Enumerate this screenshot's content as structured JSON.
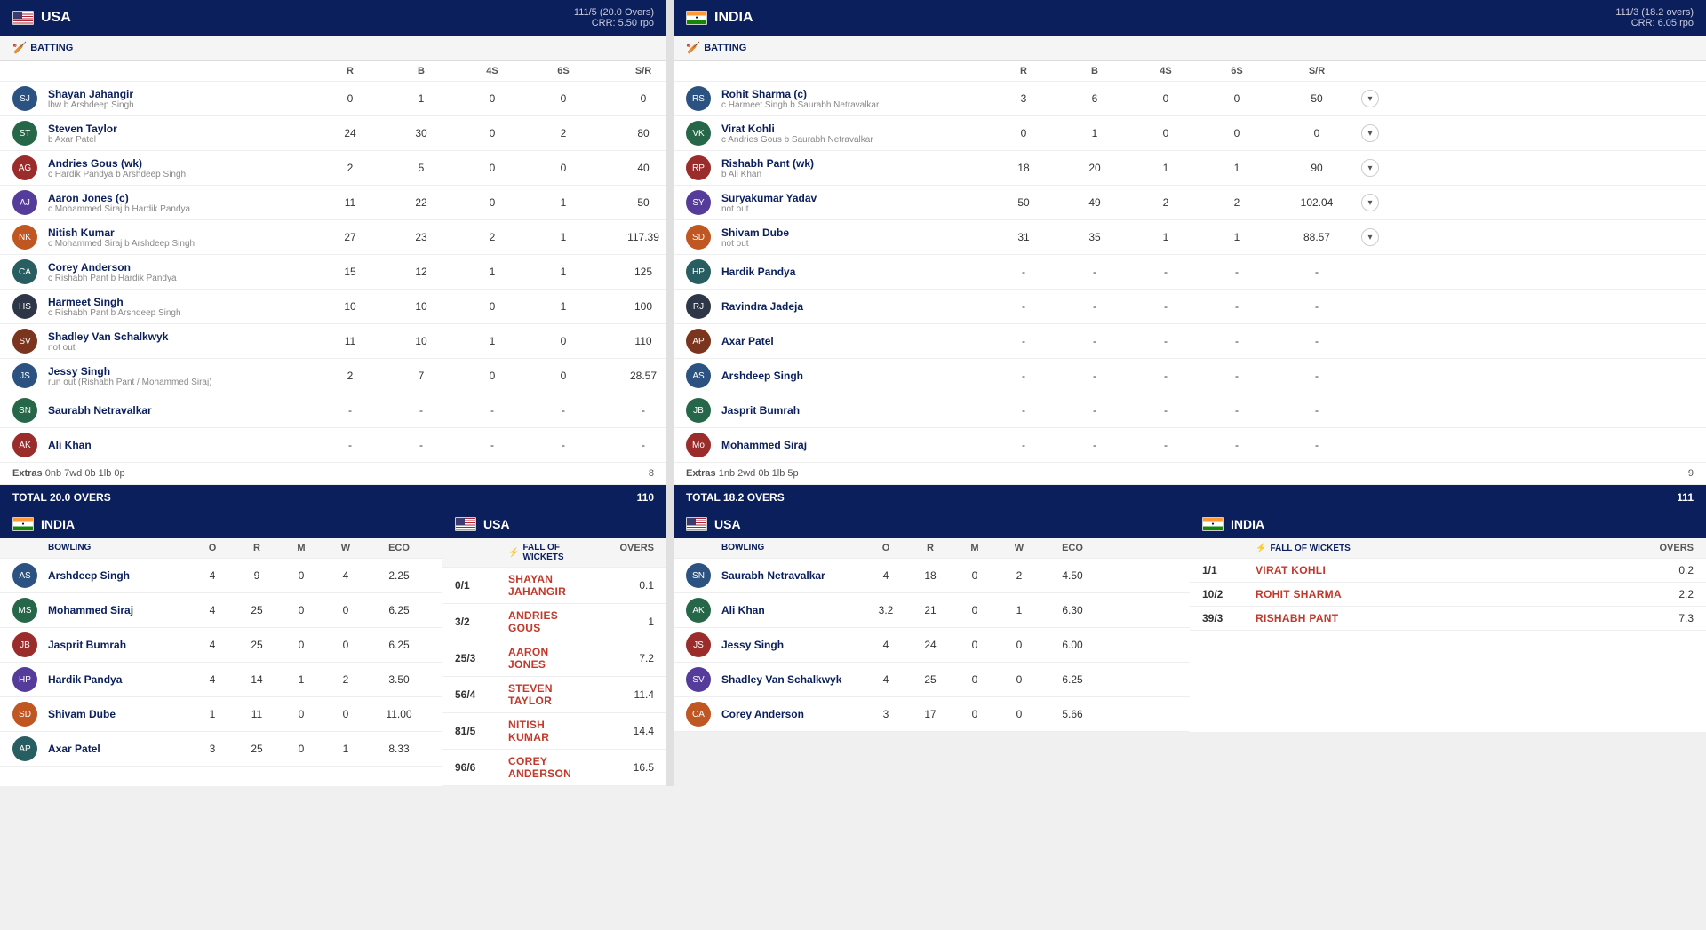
{
  "usa_batting": {
    "team": "USA",
    "score_header": "111/5 (20.0 Overs)",
    "crr": "CRR: 5.50 rpo",
    "batting_label": "BATTING",
    "columns": [
      "R",
      "B",
      "4S",
      "6S",
      "S/R"
    ],
    "players": [
      {
        "name": "Shayan Jahangir",
        "detail": "lbw b Arshdeep Singh",
        "r": "0",
        "b": "1",
        "4s": "0",
        "6s": "0",
        "sr": "0"
      },
      {
        "name": "Steven Taylor",
        "detail": "b Axar Patel",
        "r": "24",
        "b": "30",
        "4s": "0",
        "6s": "2",
        "sr": "80"
      },
      {
        "name": "Andries Gous (wk)",
        "detail": "c Hardik Pandya b Arshdeep Singh",
        "r": "2",
        "b": "5",
        "4s": "0",
        "6s": "0",
        "sr": "40"
      },
      {
        "name": "Aaron Jones (c)",
        "detail": "c Mohammed Siraj b Hardik Pandya",
        "r": "11",
        "b": "22",
        "4s": "0",
        "6s": "1",
        "sr": "50"
      },
      {
        "name": "Nitish Kumar",
        "detail": "c Mohammed Siraj b Arshdeep Singh",
        "r": "27",
        "b": "23",
        "4s": "2",
        "6s": "1",
        "sr": "117.39"
      },
      {
        "name": "Corey Anderson",
        "detail": "c Rishabh Pant b Hardik Pandya",
        "r": "15",
        "b": "12",
        "4s": "1",
        "6s": "1",
        "sr": "125"
      },
      {
        "name": "Harmeet Singh",
        "detail": "c Rishabh Pant b Arshdeep Singh",
        "r": "10",
        "b": "10",
        "4s": "0",
        "6s": "1",
        "sr": "100"
      },
      {
        "name": "Shadley Van Schalkwyk",
        "detail": "not out",
        "r": "11",
        "b": "10",
        "4s": "1",
        "6s": "0",
        "sr": "110"
      },
      {
        "name": "Jessy Singh",
        "detail": "run out (Rishabh Pant / Mohammed Siraj)",
        "r": "2",
        "b": "7",
        "4s": "0",
        "6s": "0",
        "sr": "28.57"
      },
      {
        "name": "Saurabh Netravalkar",
        "detail": "",
        "r": "-",
        "b": "-",
        "4s": "-",
        "6s": "-",
        "sr": "-"
      },
      {
        "name": "Ali Khan",
        "detail": "",
        "r": "-",
        "b": "-",
        "4s": "-",
        "6s": "-",
        "sr": "-"
      }
    ],
    "extras_label": "Extras",
    "extras_detail": "0nb 7wd 0b 1lb 0p",
    "extras_val": "8",
    "total_label": "TOTAL  20.0 OVERS",
    "total_val": "110"
  },
  "india_bowling_vs_usa": {
    "team": "INDIA",
    "bowling_label": "BOWLING",
    "columns": [
      "O",
      "R",
      "M",
      "W",
      "ECO"
    ],
    "bowlers": [
      {
        "name": "Arshdeep Singh",
        "o": "4",
        "r": "9",
        "m": "0",
        "w": "4",
        "eco": "2.25"
      },
      {
        "name": "Mohammed Siraj",
        "o": "4",
        "r": "25",
        "m": "0",
        "w": "0",
        "eco": "6.25"
      },
      {
        "name": "Jasprit Bumrah",
        "o": "4",
        "r": "25",
        "m": "0",
        "w": "0",
        "eco": "6.25"
      },
      {
        "name": "Hardik Pandya",
        "o": "4",
        "r": "14",
        "m": "1",
        "w": "2",
        "eco": "3.50"
      },
      {
        "name": "Shivam Dube",
        "o": "1",
        "r": "11",
        "m": "0",
        "w": "0",
        "eco": "11.00"
      },
      {
        "name": "Axar Patel",
        "o": "3",
        "r": "25",
        "m": "0",
        "w": "1",
        "eco": "8.33"
      }
    ]
  },
  "usa_fow": {
    "team": "USA",
    "fow_label": "FALL OF WICKETS",
    "overs_label": "OVERS",
    "wickets": [
      {
        "score": "0/1",
        "player": "SHAYAN JAHANGIR",
        "overs": "0.1"
      },
      {
        "score": "3/2",
        "player": "ANDRIES GOUS",
        "overs": "1"
      },
      {
        "score": "25/3",
        "player": "AARON JONES",
        "overs": "7.2"
      },
      {
        "score": "56/4",
        "player": "STEVEN TAYLOR",
        "overs": "11.4"
      },
      {
        "score": "81/5",
        "player": "NITISH KUMAR",
        "overs": "14.4"
      },
      {
        "score": "96/6",
        "player": "COREY ANDERSON",
        "overs": "16.5"
      }
    ]
  },
  "india_batting": {
    "team": "INDIA",
    "score_header": "111/3 (18.2 overs)",
    "crr": "CRR: 6.05 rpo",
    "batting_label": "BATTING",
    "columns": [
      "R",
      "B",
      "4S",
      "6S",
      "S/R"
    ],
    "players": [
      {
        "name": "Rohit Sharma (c)",
        "detail": "c Harmeet Singh b Saurabh Netravalkar",
        "r": "3",
        "b": "6",
        "4s": "0",
        "6s": "0",
        "sr": "50"
      },
      {
        "name": "Virat Kohli",
        "detail": "c Andries Gous b Saurabh Netravalkar",
        "r": "0",
        "b": "1",
        "4s": "0",
        "6s": "0",
        "sr": "0"
      },
      {
        "name": "Rishabh Pant (wk)",
        "detail": "b Ali Khan",
        "r": "18",
        "b": "20",
        "4s": "1",
        "6s": "1",
        "sr": "90"
      },
      {
        "name": "Suryakumar Yadav",
        "detail": "not out",
        "r": "50",
        "b": "49",
        "4s": "2",
        "6s": "2",
        "sr": "102.04"
      },
      {
        "name": "Shivam Dube",
        "detail": "not out",
        "r": "31",
        "b": "35",
        "4s": "1",
        "6s": "1",
        "sr": "88.57"
      },
      {
        "name": "Hardik Pandya",
        "detail": "",
        "r": "-",
        "b": "-",
        "4s": "-",
        "6s": "-",
        "sr": "-"
      },
      {
        "name": "Ravindra Jadeja",
        "detail": "",
        "r": "-",
        "b": "-",
        "4s": "-",
        "6s": "-",
        "sr": "-"
      },
      {
        "name": "Axar Patel",
        "detail": "",
        "r": "-",
        "b": "-",
        "4s": "-",
        "6s": "-",
        "sr": "-"
      },
      {
        "name": "Arshdeep Singh",
        "detail": "",
        "r": "-",
        "b": "-",
        "4s": "-",
        "6s": "-",
        "sr": "-"
      },
      {
        "name": "Jasprit Bumrah",
        "detail": "",
        "r": "-",
        "b": "-",
        "4s": "-",
        "6s": "-",
        "sr": "-"
      },
      {
        "name": "Mohammed Siraj",
        "detail": "",
        "r": "-",
        "b": "-",
        "4s": "-",
        "6s": "-",
        "sr": "-"
      }
    ],
    "extras_label": "Extras",
    "extras_detail": "1nb 2wd 0b 1lb 5p",
    "extras_val": "9",
    "total_label": "TOTAL  18.2 OVERS",
    "total_val": "111"
  },
  "usa_bowling_vs_india": {
    "team": "USA",
    "bowling_label": "BOWLING",
    "columns": [
      "O",
      "R",
      "M",
      "W",
      "ECO"
    ],
    "bowlers": [
      {
        "name": "Saurabh Netravalkar",
        "o": "4",
        "r": "18",
        "m": "0",
        "w": "2",
        "eco": "4.50"
      },
      {
        "name": "Ali Khan",
        "o": "3.2",
        "r": "21",
        "m": "0",
        "w": "1",
        "eco": "6.30"
      },
      {
        "name": "Jessy Singh",
        "o": "4",
        "r": "24",
        "m": "0",
        "w": "0",
        "eco": "6.00"
      },
      {
        "name": "Shadley Van Schalkwyk",
        "o": "4",
        "r": "25",
        "m": "0",
        "w": "0",
        "eco": "6.25"
      },
      {
        "name": "Corey Anderson",
        "o": "3",
        "r": "17",
        "m": "0",
        "w": "0",
        "eco": "5.66"
      }
    ]
  },
  "india_fow": {
    "team": "INDIA",
    "fow_label": "FALL OF WICKETS",
    "overs_label": "OVERS",
    "wickets": [
      {
        "score": "1/1",
        "player": "VIRAT KOHLI",
        "overs": "0.2"
      },
      {
        "score": "10/2",
        "player": "ROHIT SHARMA",
        "overs": "2.2"
      },
      {
        "score": "39/3",
        "player": "RISHABH PANT",
        "overs": "7.3"
      }
    ]
  }
}
